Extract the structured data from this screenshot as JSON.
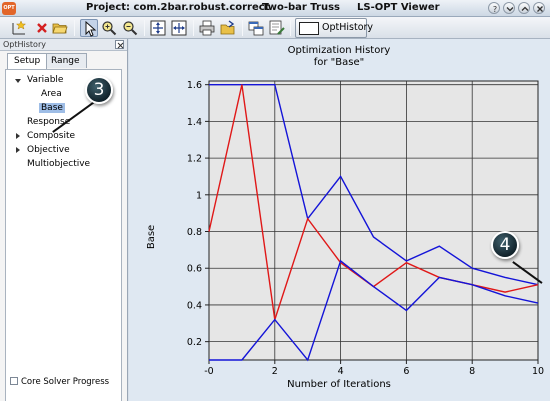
{
  "window": {
    "app_icon_text": "OPT",
    "project": "Project: com.2bar.robust.correct",
    "model": "Two-bar Truss",
    "app_name": "LS-OPT Viewer"
  },
  "toolbar": {
    "icons": [
      "new-plot-icon",
      "delete-icon",
      "open-folder-icon",
      "pointer-icon",
      "zoom-in-icon",
      "zoom-out-icon",
      "layout-1-icon",
      "layout-2-icon",
      "print-icon",
      "export-icon",
      "window-icon",
      "edit-icon"
    ],
    "optbutton_label": "OptHistory"
  },
  "panel": {
    "title": "OptHistory",
    "tabs": [
      "Setup",
      "Range"
    ],
    "tree": {
      "variable": "Variable",
      "variable_children": [
        "Area",
        "Base"
      ],
      "response": "Response",
      "composite": "Composite",
      "objective": "Objective",
      "multiobjective": "Multiobjective"
    },
    "core_solver_label": "Core Solver Progress"
  },
  "callouts": {
    "left": "3",
    "right": "4"
  },
  "colors": {
    "blue": "#1414d8",
    "red": "#e01818",
    "plot_bg": "#e6e6e6",
    "selection": "#9ebde6"
  },
  "chart_data": {
    "type": "line",
    "title": "Optimization History",
    "subtitle": "for \"Base\"",
    "xlabel": "Number of Iterations",
    "ylabel": "Base",
    "xlim": [
      0,
      10
    ],
    "ylim": [
      0.1,
      1.62
    ],
    "xticks": [
      "-0",
      "2",
      "4",
      "6",
      "8",
      "10"
    ],
    "yticks": [
      "1.6",
      "1.4",
      "1.2",
      "1",
      "0.8",
      "0.6",
      "0.4",
      "0.2"
    ],
    "grid": true,
    "series": [
      {
        "color": "#1414d8",
        "x": [
          0,
          1,
          2,
          3,
          4,
          5,
          6,
          7,
          8,
          9,
          10
        ],
        "y": [
          1.6,
          1.6,
          1.6,
          0.87,
          1.1,
          0.77,
          0.64,
          0.72,
          0.6,
          0.55,
          0.51
        ]
      },
      {
        "color": "#e01818",
        "x": [
          0,
          1,
          2,
          3,
          4,
          5,
          6,
          7,
          8,
          9,
          10
        ],
        "y": [
          0.8,
          1.6,
          0.32,
          0.87,
          0.63,
          0.5,
          0.63,
          0.55,
          0.51,
          0.47,
          0.51
        ]
      },
      {
        "color": "#1414d8",
        "x": [
          0,
          1,
          2,
          3,
          4,
          5,
          6,
          7,
          8,
          9,
          10
        ],
        "y": [
          0.1,
          0.1,
          0.32,
          0.1,
          0.64,
          0.5,
          0.37,
          0.55,
          0.51,
          0.45,
          0.41
        ]
      }
    ]
  }
}
